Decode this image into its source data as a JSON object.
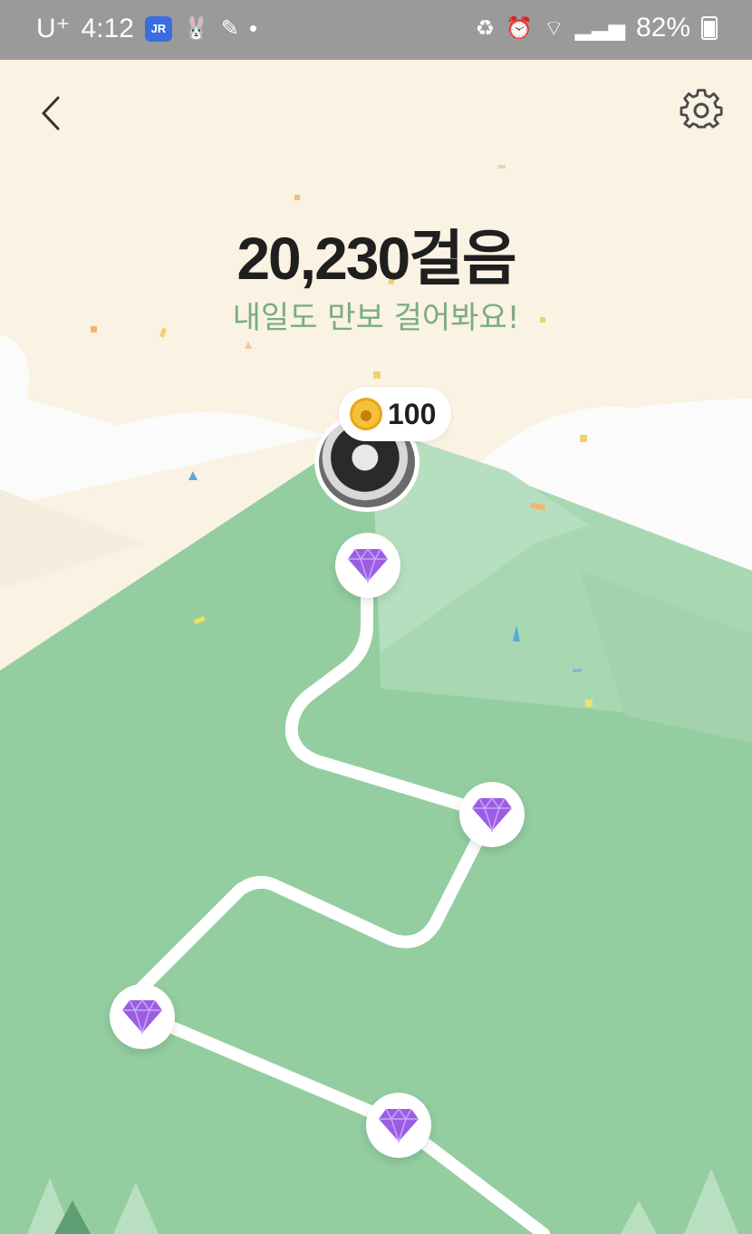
{
  "status_bar": {
    "carrier": "U⁺",
    "time": "4:12",
    "chip_text": "JR",
    "battery_text": "82%"
  },
  "header": {
    "back_icon": "chevron-left-icon",
    "settings_icon": "gear-icon"
  },
  "steps": {
    "count_text": "20,230걸음",
    "message": "내일도 만보 걸어봐요!"
  },
  "reward": {
    "coin_icon": "coin-icon",
    "amount": "100"
  },
  "avatar": {
    "icon": "profile-avatar"
  },
  "path_nodes": [
    {
      "icon": "gem-icon"
    },
    {
      "icon": "gem-icon"
    },
    {
      "icon": "gem-icon"
    },
    {
      "icon": "gem-icon"
    }
  ],
  "colors": {
    "sky": "#faf2e2",
    "mountain_light": "#b6dfbf",
    "mountain": "#93cda0",
    "subtitle": "#7aac86",
    "gem": "#9b5de5",
    "coin": "#f3c23a"
  }
}
